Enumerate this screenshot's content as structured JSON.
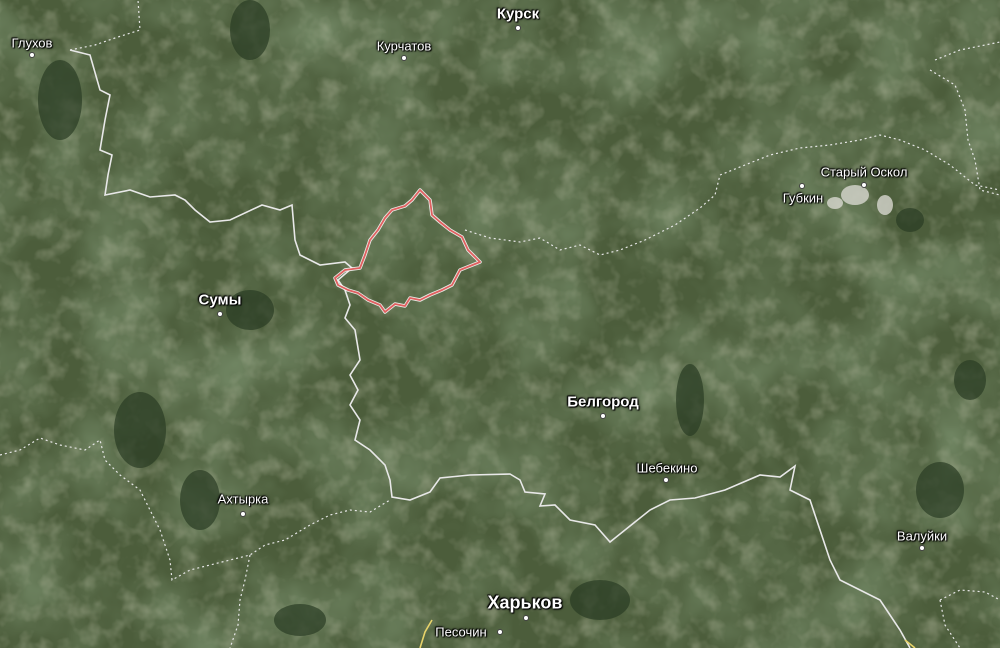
{
  "map": {
    "type": "satellite",
    "colors": {
      "terrain_base": "#4c5d3b",
      "terrain_dark": "#2f4128",
      "terrain_light": "#6b7652",
      "border_line": "#e6e6e6",
      "highlight_region": "#e06060"
    }
  },
  "cities": [
    {
      "id": "kursk",
      "name": "Курск",
      "size": "medium"
    },
    {
      "id": "kurchatov",
      "name": "Курчатов",
      "size": "small"
    },
    {
      "id": "glukhov",
      "name": "Глухов",
      "size": "small"
    },
    {
      "id": "stary-oskol",
      "name": "Старый Оскол",
      "size": "small"
    },
    {
      "id": "gubkin",
      "name": "Губкин",
      "size": "small"
    },
    {
      "id": "sumy",
      "name": "Сумы",
      "size": "medium"
    },
    {
      "id": "belgorod",
      "name": "Белгород",
      "size": "medium"
    },
    {
      "id": "shebekino",
      "name": "Шебекино",
      "size": "small"
    },
    {
      "id": "akhtyrka",
      "name": "Ахтырка",
      "size": "small"
    },
    {
      "id": "valuyki",
      "name": "Валуйки",
      "size": "small"
    },
    {
      "id": "kharkov",
      "name": "Харьков",
      "size": "large"
    },
    {
      "id": "pesochin",
      "name": "Песочин",
      "size": "small"
    }
  ]
}
